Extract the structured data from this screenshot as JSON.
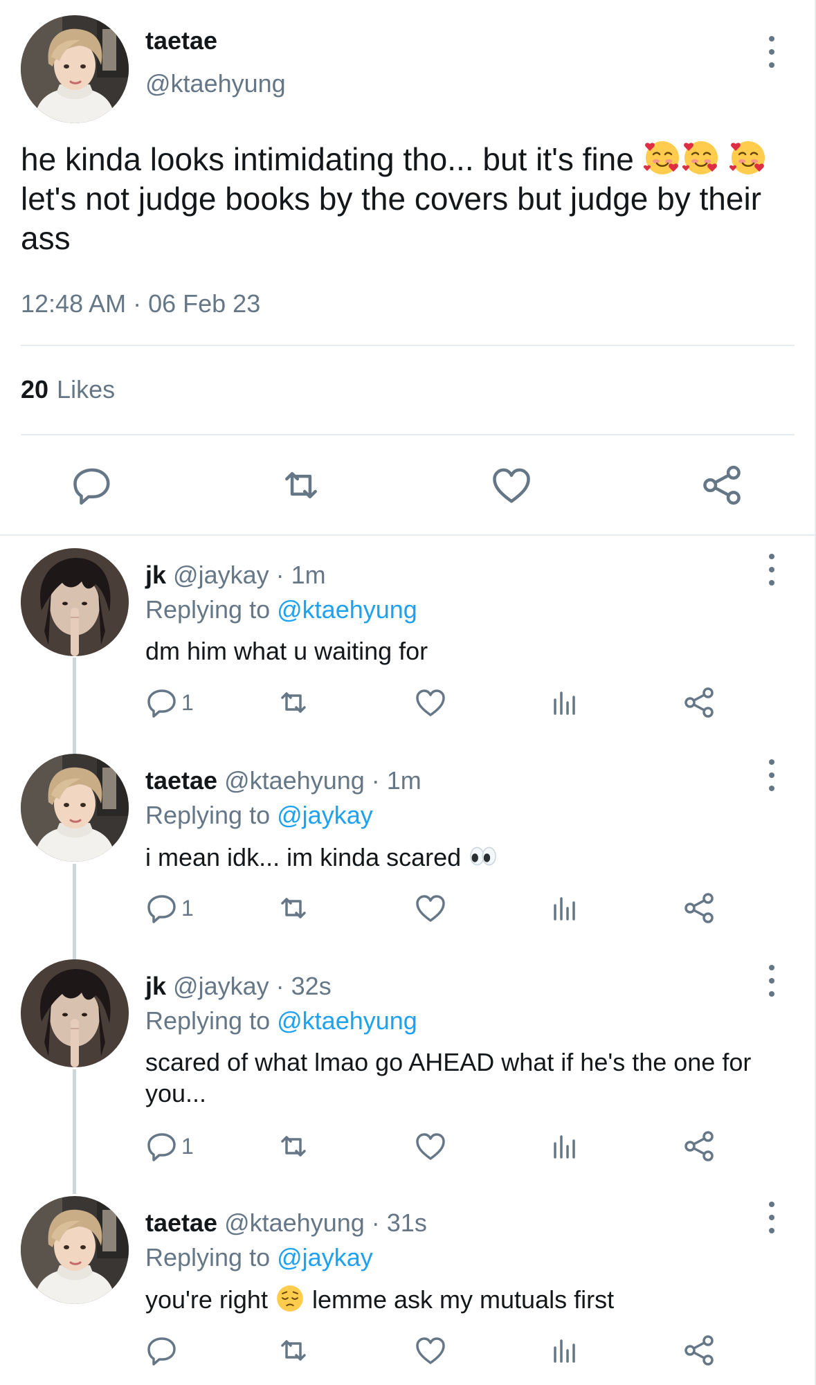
{
  "main_tweet": {
    "author_name": "taetae",
    "author_handle": "@ktaehyung",
    "text_part1": "he kinda looks intimidating tho... but it's fine",
    "text_part2": "let's not judge books by the covers but judge by their ass",
    "timestamp": "12:48 AM · 06 Feb 23",
    "likes_count": "20",
    "likes_label": "Likes",
    "emoji_inline": [
      "smiling-face-with-hearts",
      "smiling-face-with-hearts",
      "smiling-face-with-hearts"
    ],
    "actions": [
      "reply-icon",
      "retweet-icon",
      "like-icon",
      "share-icon"
    ]
  },
  "replies": [
    {
      "name": "jk",
      "handle": "@jaykay",
      "time": "· 1m",
      "replying_label": "Replying to",
      "replying_to": "@ktaehyung",
      "text": "dm him what u waiting for",
      "reply_count": "1"
    },
    {
      "name": "taetae",
      "handle": "@ktaehyung",
      "time": "· 1m",
      "replying_label": "Replying to",
      "replying_to": "@jaykay",
      "text": "i mean idk... im kinda scared",
      "text_emoji": "eyes",
      "reply_count": "1"
    },
    {
      "name": "jk",
      "handle": "@jaykay",
      "time": "· 32s",
      "replying_label": "Replying to",
      "replying_to": "@ktaehyung",
      "text": "scared of what lmao go AHEAD what if he's the one for you...",
      "reply_count": "1"
    },
    {
      "name": "taetae",
      "handle": "@ktaehyung",
      "time": "· 31s",
      "replying_label": "Replying to",
      "replying_to": "@jaykay",
      "text_part1": "you're right",
      "text_emoji": "pensive-face",
      "text_part2": "lemme ask my mutuals first",
      "reply_count": ""
    }
  ],
  "colors": {
    "text": "#14171a",
    "secondary": "#657786",
    "mention": "#1da1f2",
    "divider": "#e6ecf0",
    "thread_line": "#ccd6dd"
  }
}
